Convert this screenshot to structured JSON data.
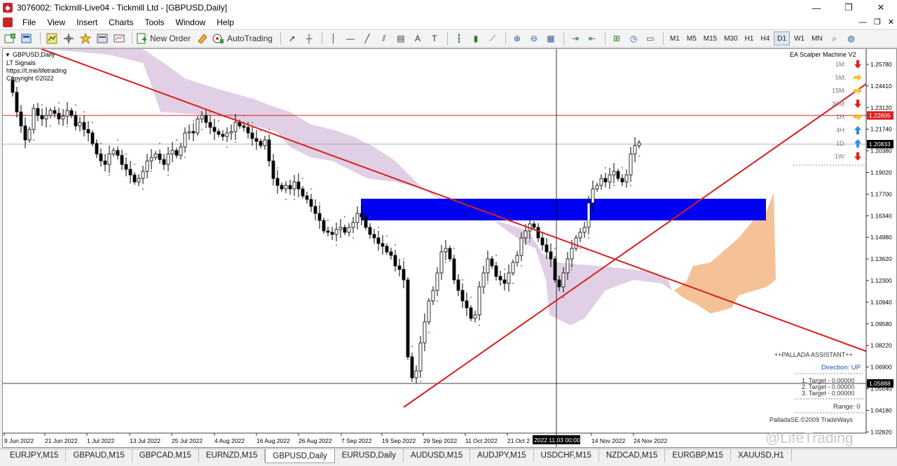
{
  "window": {
    "title": "3076002: Tickmill-Live04 - Tickmill Ltd - [GBPUSD,Daily]",
    "minimize": "—",
    "maximize": "❐",
    "close": "✕"
  },
  "menu": [
    "File",
    "View",
    "Insert",
    "Charts",
    "Tools",
    "Window",
    "Help"
  ],
  "toolbar": {
    "new_order": "New Order",
    "auto_trading": "AutoTrading",
    "timeframes": [
      "M1",
      "M5",
      "M15",
      "M30",
      "H1",
      "H4",
      "D1",
      "W1",
      "MN"
    ],
    "active_timeframe": "D1"
  },
  "chart": {
    "symbol_label": "GBPUSD,Daily",
    "info_lines": [
      "LT Signals",
      "https://t.me/lifetrading",
      "Copyright ©2022"
    ],
    "ea_name": "EA Scalper Machine V2",
    "signals": [
      {
        "tf": "1M:",
        "dir": "down",
        "color": "#e02020"
      },
      {
        "tf": "5M:",
        "dir": "right",
        "color": "#f2c230"
      },
      {
        "tf": "15M:",
        "dir": "right",
        "color": "#f2c230"
      },
      {
        "tf": "30M:",
        "dir": "down",
        "color": "#e02020"
      },
      {
        "tf": "1H:",
        "dir": "right",
        "color": "#f2c230"
      },
      {
        "tf": "4H:",
        "dir": "up",
        "color": "#2b8fe0"
      },
      {
        "tf": "1D:",
        "dir": "up",
        "color": "#2b8fe0"
      },
      {
        "tf": "1W:",
        "dir": "down",
        "color": "#e02020"
      }
    ],
    "price_axis": [
      "1.25780",
      "1.24410",
      "1.23120",
      "1.21740",
      "1.20380",
      "1.19020",
      "1.17700",
      "1.16340",
      "1.14980",
      "1.13620",
      "1.12300",
      "1.10940",
      "1.09580",
      "1.08220",
      "1.06900",
      "1.05540",
      "1.04180",
      "1.02820"
    ],
    "price_tags": [
      {
        "value": "1.22605",
        "bg": "#e02020"
      },
      {
        "value": "1.20833",
        "bg": "#000000"
      },
      {
        "value": "1.05888",
        "bg": "#000000"
      }
    ],
    "date_axis": [
      "9 Jun 2022",
      "21 Jun 2022",
      "1 Jul 2022",
      "13 Jul 2022",
      "25 Jul 2022",
      "4 Aug 2022",
      "16 Aug 2022",
      "26 Aug 2022",
      "7 Sep 2022",
      "19 Sep 2022",
      "29 Sep 2022",
      "11 Oct 2022",
      "21 Oct 2",
      "14 Nov 2022",
      "24 Nov 2022"
    ],
    "crosshair_date": "2022.11.03 00:00",
    "assistant": {
      "header": "++PALLADA ASSISTANT++",
      "direction": "Direction: UP",
      "targets": [
        "1. Target - 0.00000",
        "2. Target - 0.00000",
        "3. Target - 0.00000"
      ],
      "range": "Range: 0",
      "copyright": "PalladaSE.©2009 TradeWays"
    },
    "watermark": "@LifeTrading"
  },
  "tabs": [
    "EURJPY,M15",
    "GBPAUD,M15",
    "GBPCAD,M15",
    "EURNZD,M15",
    "GBPUSD,Daily",
    "EURUSD,Daily",
    "AUDUSD,M15",
    "AUDJPY,M15",
    "USDCHF,M15",
    "NZDCAD,M15",
    "EURGBP,M15",
    "XAUUSD,H1"
  ],
  "active_tab": "GBPUSD,Daily"
}
